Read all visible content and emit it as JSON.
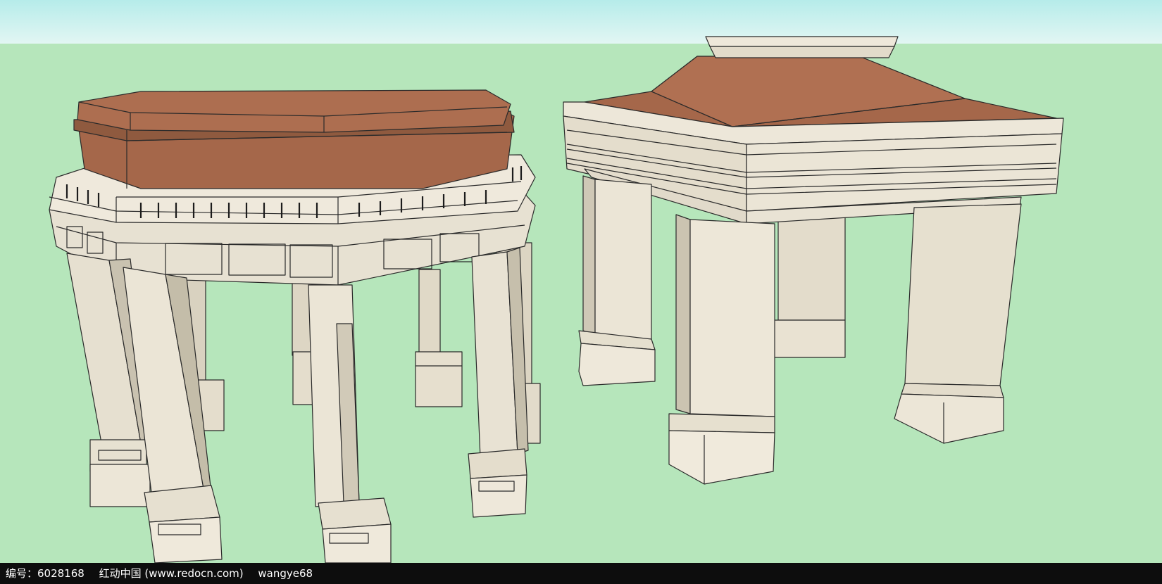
{
  "scene": {
    "sky_color": "#b8ecea",
    "ground_color": "#b6e6bb",
    "stone_color": "#e9e3d4",
    "stone_shade_color": "#cfc8b6",
    "roof_color": "#a5674a",
    "roof_shade_color": "#8a5237",
    "objects": [
      "octagonal-gazebo",
      "square-pavilion"
    ]
  },
  "footer": {
    "id_text": "编号：6028168",
    "site_text": "红动中国 (www.redocn.com)",
    "author_text": "wangye68"
  }
}
